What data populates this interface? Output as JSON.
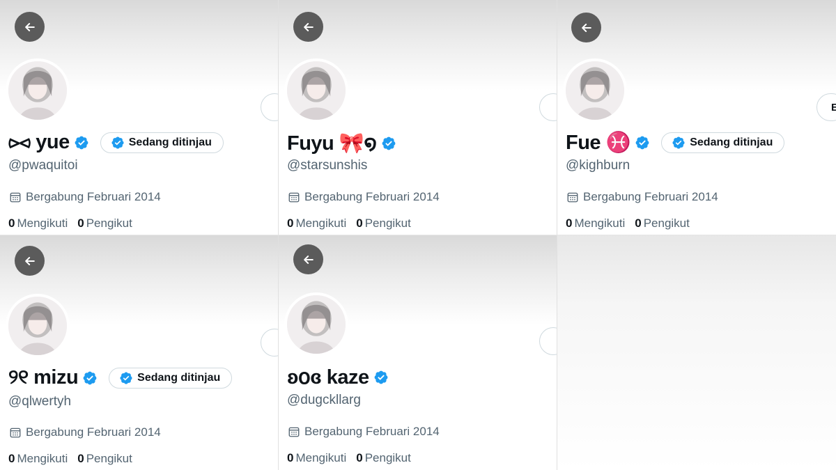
{
  "colors": {
    "verified": "#1d9bf0",
    "back_button": "#5b5b5b",
    "text_primary": "#0f1419",
    "text_secondary": "#536471"
  },
  "icons": {
    "back": "arrow-left-icon",
    "verified": "verified-badge-icon",
    "calendar": "calendar-icon"
  },
  "profiles": [
    {
      "display_name": "⪧⪦ yue",
      "review_badge": "Sedang ditinjau",
      "handle": "@pwaquitoi",
      "joined": "Bergabung Februari 2014",
      "following_count": "0",
      "following_label": "Mengikuti",
      "followers_count": "0",
      "followers_label": "Pengikut",
      "follow_button": ""
    },
    {
      "display_name": "Fuyu 🎀໑",
      "review_badge": "",
      "handle": "@starsunshis",
      "joined": "Bergabung Februari 2014",
      "following_count": "0",
      "following_label": "Mengikuti",
      "followers_count": "0",
      "followers_label": "Pengikut",
      "follow_button": ""
    },
    {
      "display_name": "Fue ♓",
      "review_badge": "Sedang ditinjau",
      "handle": "@kighburn",
      "joined": "Bergabung Februari 2014",
      "following_count": "0",
      "following_label": "Mengikuti",
      "followers_count": "0",
      "followers_label": "Pengikut",
      "follow_button": "E"
    },
    {
      "display_name": "୨୧ mizu",
      "review_badge": "Sedang ditinjau",
      "handle": "@qlwertyh",
      "joined": "Bergabung Februari 2014",
      "following_count": "0",
      "following_label": "Mengikuti",
      "followers_count": "0",
      "followers_label": "Pengikut",
      "follow_button": ""
    },
    {
      "display_name": "ʚ𝗈ɞ kaze",
      "review_badge": "",
      "handle": "@dugckllarg",
      "joined": "Bergabung Februari 2014",
      "following_count": "0",
      "following_label": "Mengikuti",
      "followers_count": "0",
      "followers_label": "Pengikut",
      "follow_button": ""
    }
  ]
}
